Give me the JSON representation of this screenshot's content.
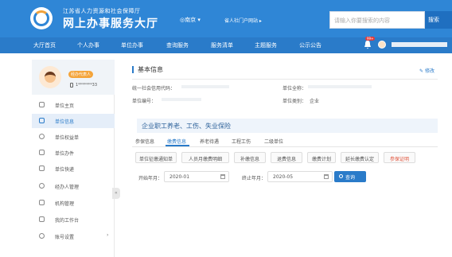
{
  "header": {
    "org_name": "江苏省人力资源和社会保障厅",
    "site_title": "网上办事服务大厅",
    "city": "◎南京 ▾",
    "portal_link": "省人社门户网站 ▸",
    "search_placeholder": "请输入你要搜索的内容",
    "search_button": "搜索",
    "bell_badge": "99+"
  },
  "nav": {
    "items": [
      "大厅首页",
      "个人办事",
      "单位办事",
      "查询服务",
      "服务清单",
      "主题服务",
      "公示公告"
    ]
  },
  "sidebar": {
    "role_badge": "经办代表人",
    "phone": "1*******33",
    "items": [
      {
        "label": "单位主页",
        "icon": "home-icon"
      },
      {
        "label": "单位信息",
        "icon": "building-icon"
      },
      {
        "label": "单位权益单",
        "icon": "location-icon"
      },
      {
        "label": "单位办件",
        "icon": "document-icon"
      },
      {
        "label": "单位快递",
        "icon": "truck-icon"
      },
      {
        "label": "经办人管理",
        "icon": "user-icon"
      },
      {
        "label": "机构管理",
        "icon": "org-icon"
      },
      {
        "label": "我的工作台",
        "icon": "desk-icon"
      },
      {
        "label": "账号设置",
        "icon": "gear-icon"
      }
    ]
  },
  "main": {
    "section_title": "基本信息",
    "edit_label": "修改",
    "info": {
      "credit_code_label": "统一社会信用代码：",
      "unit_name_label": "单位全称：",
      "unit_no_label": "单位编号：",
      "unit_type_label": "单位类别：",
      "unit_type_value": "企业"
    },
    "insurance_title": "企业职工养老、工伤、失业保险",
    "tabs": [
      "参保信息",
      "缴费信息",
      "养老待遇",
      "工程工伤",
      "二级单位"
    ],
    "sub_buttons": [
      "单位征缴通知单",
      "人员月缴费明细",
      "补缴信息",
      "退费信息",
      "缴费计划",
      "延长缴费认定",
      "参保证明"
    ],
    "start_label": "开始年月：",
    "start_value": "2020-01",
    "end_label": "终止年月：",
    "end_value": "2020-05",
    "query_button": "查询"
  }
}
